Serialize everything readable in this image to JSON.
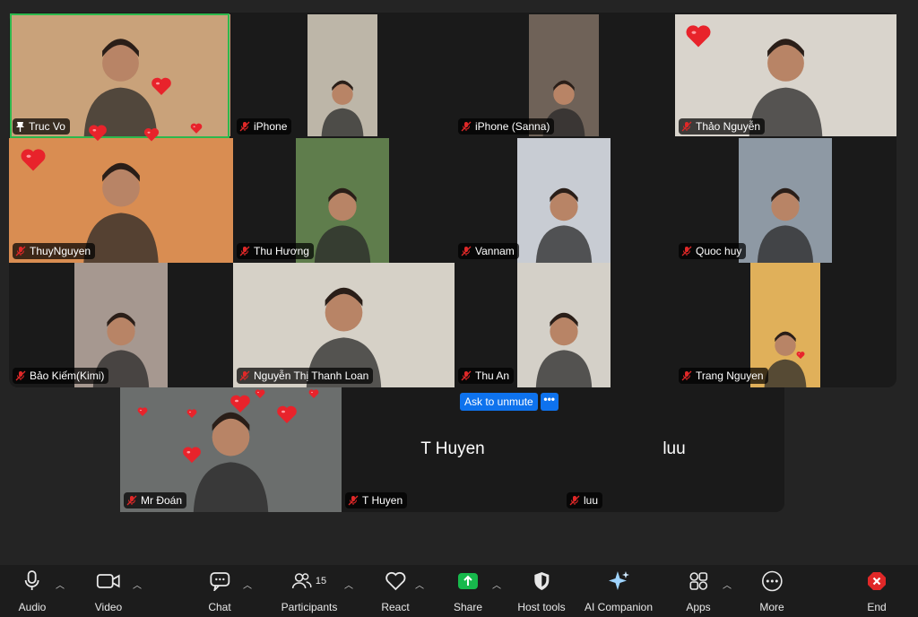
{
  "participants": [
    {
      "name": "Truc Vo",
      "muted": false,
      "pinned": true,
      "active": true,
      "bg": "#c9a27a"
    },
    {
      "name": "iPhone",
      "muted": true,
      "bg": "#bdb6a8"
    },
    {
      "name": "iPhone (Sanna)",
      "muted": true,
      "bg": "#6f6258"
    },
    {
      "name": "Thảo Nguyễn",
      "muted": true,
      "bg": "#d9d4cc"
    },
    {
      "name": "ThuyNguyen",
      "muted": true,
      "bg": "#d98d52"
    },
    {
      "name": "Thu Hương",
      "muted": true,
      "bg": "#5f7d4c"
    },
    {
      "name": "Vannam",
      "muted": true,
      "bg": "#c8ccd3"
    },
    {
      "name": "Quoc huy",
      "muted": true,
      "bg": "#8e99a4"
    },
    {
      "name": "Bảo Kiếm(Kimi)",
      "muted": true,
      "bg": "#a69890"
    },
    {
      "name": "Nguyễn Thị Thanh Loan",
      "muted": true,
      "bg": "#d6d1c7"
    },
    {
      "name": "Thu An",
      "muted": true,
      "bg": "#d4d0c8"
    },
    {
      "name": "Trang Nguyen",
      "muted": true,
      "bg": "#e0b05a"
    },
    {
      "name": "Mr Đoán",
      "muted": true,
      "bg": "#6b6e6d"
    },
    {
      "name": "T Huyen",
      "muted": true,
      "bg": "#1a1a1a",
      "avatar_text": "T Huyen"
    },
    {
      "name": "luu",
      "muted": true,
      "bg": "#1a1a1a",
      "avatar_text": "luu"
    }
  ],
  "unmute_prompt": {
    "label": "Ask to unmute",
    "more": "•••"
  },
  "toolbar": {
    "audio": "Audio",
    "video": "Video",
    "chat": "Chat",
    "participants": "Participants",
    "participants_count": "15",
    "react": "React",
    "share": "Share",
    "host_tools": "Host tools",
    "ai_companion": "AI Companion",
    "apps": "Apps",
    "more": "More",
    "end": "End"
  },
  "icons": {
    "audio": "microphone-icon",
    "video": "camera-icon",
    "chat": "chat-bubble-icon",
    "participants": "people-icon",
    "react": "heart-outline-icon",
    "share": "share-arrow-icon",
    "host_tools": "shield-icon",
    "ai_companion": "sparkle-icon",
    "apps": "apps-icon",
    "more": "ellipsis-icon",
    "end": "close-icon"
  },
  "colors": {
    "accent": "#0e72ed",
    "active_speaker": "#2db84d",
    "share_green": "#17b94c",
    "end_red": "#e02828",
    "heart_red": "#e8232b"
  }
}
